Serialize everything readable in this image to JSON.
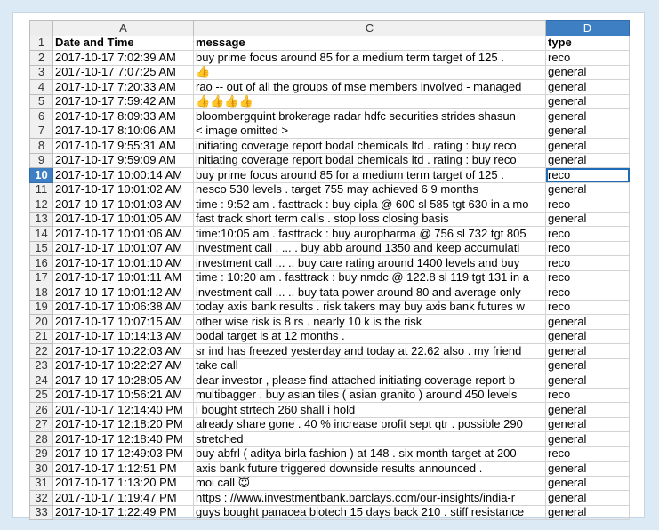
{
  "columns": {
    "row_header": "",
    "a": "A",
    "c": "C",
    "d": "D"
  },
  "header_row": {
    "number": "1",
    "date": "Date and Time",
    "message": "message",
    "type": "type"
  },
  "rows": [
    {
      "n": "2",
      "date": "2017-10-17 7:02:39 AM",
      "message": "buy prime focus around 85 for a medium term target of 125 .",
      "type": "reco"
    },
    {
      "n": "3",
      "date": "2017-10-17 7:07:25 AM",
      "message": "👍",
      "type": "general"
    },
    {
      "n": "4",
      "date": "2017-10-17 7:20:33 AM",
      "message": "rao -- out of all the groups of mse members involved - managed",
      "type": "general"
    },
    {
      "n": "5",
      "date": "2017-10-17 7:59:42 AM",
      "message": "👍👍👍👍",
      "type": "general"
    },
    {
      "n": "6",
      "date": "2017-10-17 8:09:33 AM",
      "message": "bloombergquint brokerage radar hdfc securities strides shasun",
      "type": "general"
    },
    {
      "n": "7",
      "date": "2017-10-17 8:10:06 AM",
      "message": "< image omitted >",
      "type": "general"
    },
    {
      "n": "8",
      "date": "2017-10-17 9:55:31 AM",
      "message": "initiating coverage report bodal chemicals ltd . rating : buy reco",
      "type": "general"
    },
    {
      "n": "9",
      "date": "2017-10-17 9:59:09 AM",
      "message": "initiating coverage report bodal chemicals ltd . rating : buy reco",
      "type": "general"
    },
    {
      "n": "10",
      "date": "2017-10-17 10:00:14 AM",
      "message": "buy prime focus around 85 for a medium term target of 125 .",
      "type": "reco"
    },
    {
      "n": "11",
      "date": "2017-10-17 10:01:02 AM",
      "message": "nesco 530 levels . target 755 may achieved 6 9 months",
      "type": "general"
    },
    {
      "n": "12",
      "date": "2017-10-17 10:01:03 AM",
      "message": "time : 9:52 am . fasttrack : buy cipla @ 600 sl 585 tgt 630 in a mo",
      "type": "reco"
    },
    {
      "n": "13",
      "date": "2017-10-17 10:01:05 AM",
      "message": "fast track short term calls . stop loss closing basis",
      "type": "general"
    },
    {
      "n": "14",
      "date": "2017-10-17 10:01:06 AM",
      "message": "time:10:05 am . fasttrack : buy auropharma @ 756 sl 732 tgt 805",
      "type": "reco"
    },
    {
      "n": "15",
      "date": "2017-10-17 10:01:07 AM",
      "message": "investment call . ... . buy abb around 1350 and keep accumulati",
      "type": "reco"
    },
    {
      "n": "16",
      "date": "2017-10-17 10:01:10 AM",
      "message": "investment call ... .. buy care rating around 1400 levels and buy",
      "type": "reco"
    },
    {
      "n": "17",
      "date": "2017-10-17 10:01:11 AM",
      "message": "time : 10:20 am . fasttrack : buy nmdc @ 122.8 sl 119 tgt 131 in a",
      "type": "reco"
    },
    {
      "n": "18",
      "date": "2017-10-17 10:01:12 AM",
      "message": "investment call ... .. buy tata power around 80 and average only",
      "type": "reco"
    },
    {
      "n": "19",
      "date": "2017-10-17 10:06:38 AM",
      "message": "today axis bank results . risk takers may buy axis bank futures w",
      "type": "reco"
    },
    {
      "n": "20",
      "date": "2017-10-17 10:07:15 AM",
      "message": "other wise risk is 8 rs . nearly 10 k is the risk",
      "type": "general"
    },
    {
      "n": "21",
      "date": "2017-10-17 10:14:13 AM",
      "message": "bodal target is at 12 months .",
      "type": "general"
    },
    {
      "n": "22",
      "date": "2017-10-17 10:22:03 AM",
      "message": "sr ind has freezed yesterday and today at 22.62 also . my friend",
      "type": "general"
    },
    {
      "n": "23",
      "date": "2017-10-17 10:22:27 AM",
      "message": "take call",
      "type": "general"
    },
    {
      "n": "24",
      "date": "2017-10-17 10:28:05 AM",
      "message": "dear investor , please find attached initiating coverage report b",
      "type": "general"
    },
    {
      "n": "25",
      "date": "2017-10-17 10:56:21 AM",
      "message": "multibagger . buy asian tiles ( asian granito ) around 450 levels",
      "type": "reco"
    },
    {
      "n": "26",
      "date": "2017-10-17 12:14:40 PM",
      "message": "i bought strtech 260 shall i hold",
      "type": "general"
    },
    {
      "n": "27",
      "date": "2017-10-17 12:18:20 PM",
      "message": "already share gone . 40 % increase profit sept qtr . possible 290",
      "type": "general"
    },
    {
      "n": "28",
      "date": "2017-10-17 12:18:40 PM",
      "message": "stretched",
      "type": "general"
    },
    {
      "n": "29",
      "date": "2017-10-17 12:49:03 PM",
      "message": "buy abfrl ( aditya birla fashion ) at 148 . six month target at 200",
      "type": "reco"
    },
    {
      "n": "30",
      "date": "2017-10-17 1:12:51 PM",
      "message": "axis bank future triggered downside results announced .",
      "type": "general"
    },
    {
      "n": "31",
      "date": "2017-10-17 1:13:20 PM",
      "message": "moi call 😇",
      "type": "general"
    },
    {
      "n": "32",
      "date": "2017-10-17 1:19:47 PM",
      "message": "https : //www.investmentbank.barclays.com/our-insights/india-r",
      "type": "general"
    },
    {
      "n": "33",
      "date": "2017-10-17 1:22:49 PM",
      "message": "guys bought panacea biotech 15 days back 210 . stiff resistance",
      "type": "general"
    }
  ],
  "selection": {
    "row": "10",
    "column": "D"
  },
  "colors": {
    "accent": "#3e7fc4",
    "selection_border": "#1e6bb8",
    "background": "#dceaf5"
  }
}
